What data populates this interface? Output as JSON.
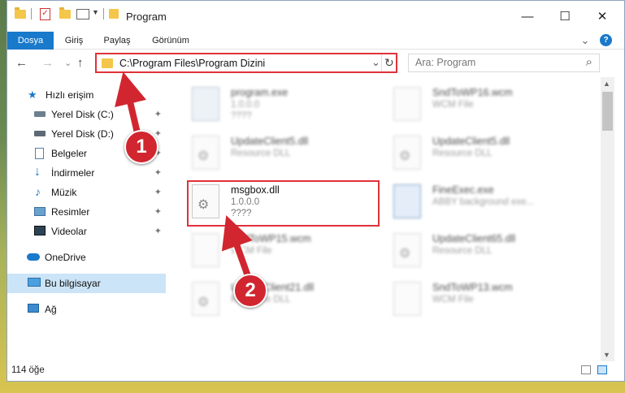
{
  "window": {
    "title": "Program",
    "minimize_glyph": "—",
    "maximize_glyph": "☐",
    "close_glyph": "✕"
  },
  "ribbon": {
    "tabs": [
      "Dosya",
      "Giriş",
      "Paylaş",
      "Görünüm"
    ],
    "expand_glyph": "⌄",
    "help_glyph": "?"
  },
  "navigation": {
    "back_glyph": "←",
    "forward_glyph": "→",
    "history_glyph": "⌄",
    "up_glyph": "↑",
    "address": "C:\\Program Files\\Program Dizini",
    "refresh_glyph": "↻",
    "dropdown_glyph": "⌄",
    "search_placeholder": "Ara: Program",
    "search_glyph": "⌕"
  },
  "sidebar": {
    "items": [
      {
        "label": "Hızlı erişim",
        "icon": "star-icon",
        "pinned": false
      },
      {
        "label": "Yerel Disk (C:)",
        "icon": "drive-icon",
        "pinned": true
      },
      {
        "label": "Yerel Disk (D:)",
        "icon": "drive-icon",
        "pinned": true
      },
      {
        "label": "Belgeler",
        "icon": "documents-icon",
        "pinned": true
      },
      {
        "label": "İndirmeler",
        "icon": "download-icon",
        "pinned": true
      },
      {
        "label": "Müzik",
        "icon": "music-icon",
        "pinned": true
      },
      {
        "label": "Resimler",
        "icon": "pictures-icon",
        "pinned": true
      },
      {
        "label": "Videolar",
        "icon": "video-icon",
        "pinned": true
      },
      {
        "label": "OneDrive",
        "icon": "cloud-icon",
        "pinned": false
      },
      {
        "label": "Bu bilgisayar",
        "icon": "computer-icon",
        "pinned": false,
        "selected": true
      },
      {
        "label": "Ağ",
        "icon": "network-icon",
        "pinned": false
      }
    ],
    "pin_glyph": "📌"
  },
  "files": [
    {
      "name": "program.exe",
      "line1": "1.0.0.0",
      "line2": "????",
      "icon": "exe-icon",
      "highlighted": false
    },
    {
      "name": "SndToWP16.wcm",
      "line1": "WCM File",
      "line2": "",
      "icon": "blank-file-icon",
      "highlighted": false
    },
    {
      "name": "UpdateClient5.dll",
      "line1": "Resource DLL",
      "line2": "",
      "icon": "dll-icon",
      "highlighted": false
    },
    {
      "name": "UpdateClient5.dll",
      "line1": "Resource DLL",
      "line2": "",
      "icon": "dll-icon",
      "highlighted": false
    },
    {
      "name": "msgbox.dll",
      "line1": "1.0.0.0",
      "line2": "????",
      "icon": "dll-icon",
      "highlighted": true
    },
    {
      "name": "FineExec.exe",
      "line1": "ABBY background exe...",
      "line2": "",
      "icon": "exe-icon",
      "highlighted": false
    },
    {
      "name": "SndToWP15.wcm",
      "line1": "WCM File",
      "line2": "",
      "icon": "blank-file-icon",
      "highlighted": false
    },
    {
      "name": "UpdateClient65.dll",
      "line1": "Resource DLL",
      "line2": "",
      "icon": "dll-icon",
      "highlighted": false
    },
    {
      "name": "UpdateClient21.dll",
      "line1": "Resource DLL",
      "line2": "",
      "icon": "dll-icon",
      "highlighted": false
    },
    {
      "name": "SndToWP13.wcm",
      "line1": "WCM File",
      "line2": "",
      "icon": "blank-file-icon",
      "highlighted": false
    }
  ],
  "status": {
    "item_count": "114 öğe"
  },
  "annotations": {
    "callout_1": "1",
    "callout_2": "2",
    "accent": "#d1262f"
  },
  "colors": {
    "ribbon_file_tab": "#1979ca",
    "highlight_border": "#e0323b",
    "selected_bg": "#cce4f7"
  }
}
